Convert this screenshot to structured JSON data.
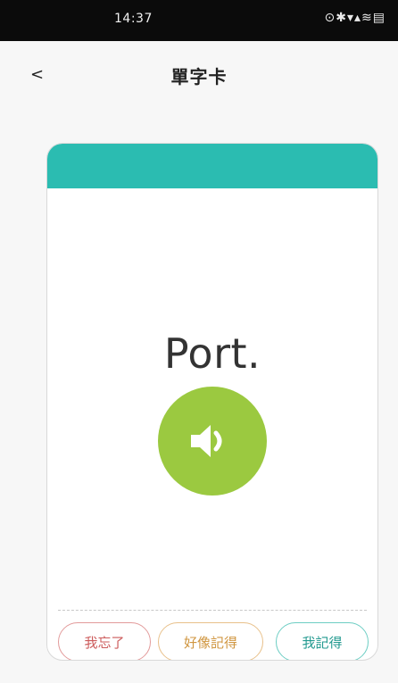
{
  "status_bar": {
    "time": "14:37",
    "icons_text": "⊙✱▾▴≋▤"
  },
  "header": {
    "back_label": "<",
    "title": "單字卡"
  },
  "card": {
    "accent_color": "#2bbcb1",
    "word": "Port.",
    "speak_icon": "speaker-icon",
    "speak_color": "#9bc940",
    "actions": {
      "forgot_label": "我忘了",
      "maybe_label": "好像記得",
      "remember_label": "我記得"
    }
  }
}
